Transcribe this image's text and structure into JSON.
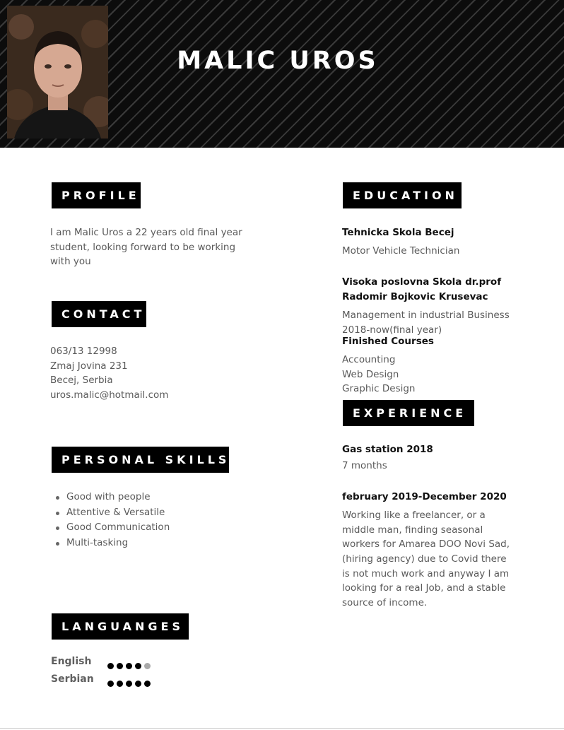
{
  "header": {
    "name": "MALIC UROS"
  },
  "profile": {
    "title": "PROFILE",
    "lines": [
      "I am Malic Uros a 22 years old final year",
      "student, looking forward to be working",
      "with you"
    ]
  },
  "contact": {
    "title": "CONTACT",
    "phone": "063/13 12998",
    "address": "Zmaj Jovina 231",
    "city": "Becej, Serbia",
    "email": "uros.malic@hotmail.com"
  },
  "personal_skills": {
    "title": "PERSONAL SKILLS",
    "items": [
      "Good with people",
      "Attentive & Versatile",
      "Good Communication",
      "Multi-tasking"
    ]
  },
  "languages": {
    "title": "LANGUANGES",
    "items": [
      {
        "name": "English",
        "level": 4,
        "max": 5
      },
      {
        "name": "Serbian",
        "level": 5,
        "max": 5
      }
    ]
  },
  "education": {
    "title": "EDUCATION",
    "school1": "Tehnicka Skola Becej",
    "school1_detail": "Motor Vehicle Technician",
    "school2_line1": "Visoka poslovna Skola dr.prof",
    "school2_line2": "Radomir Bojkovic Krusevac",
    "school2_detail": "Management in industrial Business",
    "school2_years": "2018-now(final year)",
    "courses_title": "Finished Courses",
    "courses": [
      "Accounting",
      "Web Design",
      "Graphic Design"
    ]
  },
  "experience": {
    "title": "EXPERIENCE",
    "job1_title": "Gas station 2018",
    "job1_duration": "7 months",
    "job2_title": "february 2019-December 2020",
    "job2_lines": [
      "Working like a freelancer, or a",
      "middle man, finding seasonal",
      "workers for Amarea DOO Novi Sad,",
      "(hiring agency) due to Covid there",
      "is not much work and anyway I am",
      "looking for a real Job, and a stable",
      "source of income."
    ]
  },
  "colors": {
    "header_bg": "#0c0c0c",
    "title_bg": "#000000",
    "text": "#5a5a5a",
    "heading": "#111111"
  }
}
